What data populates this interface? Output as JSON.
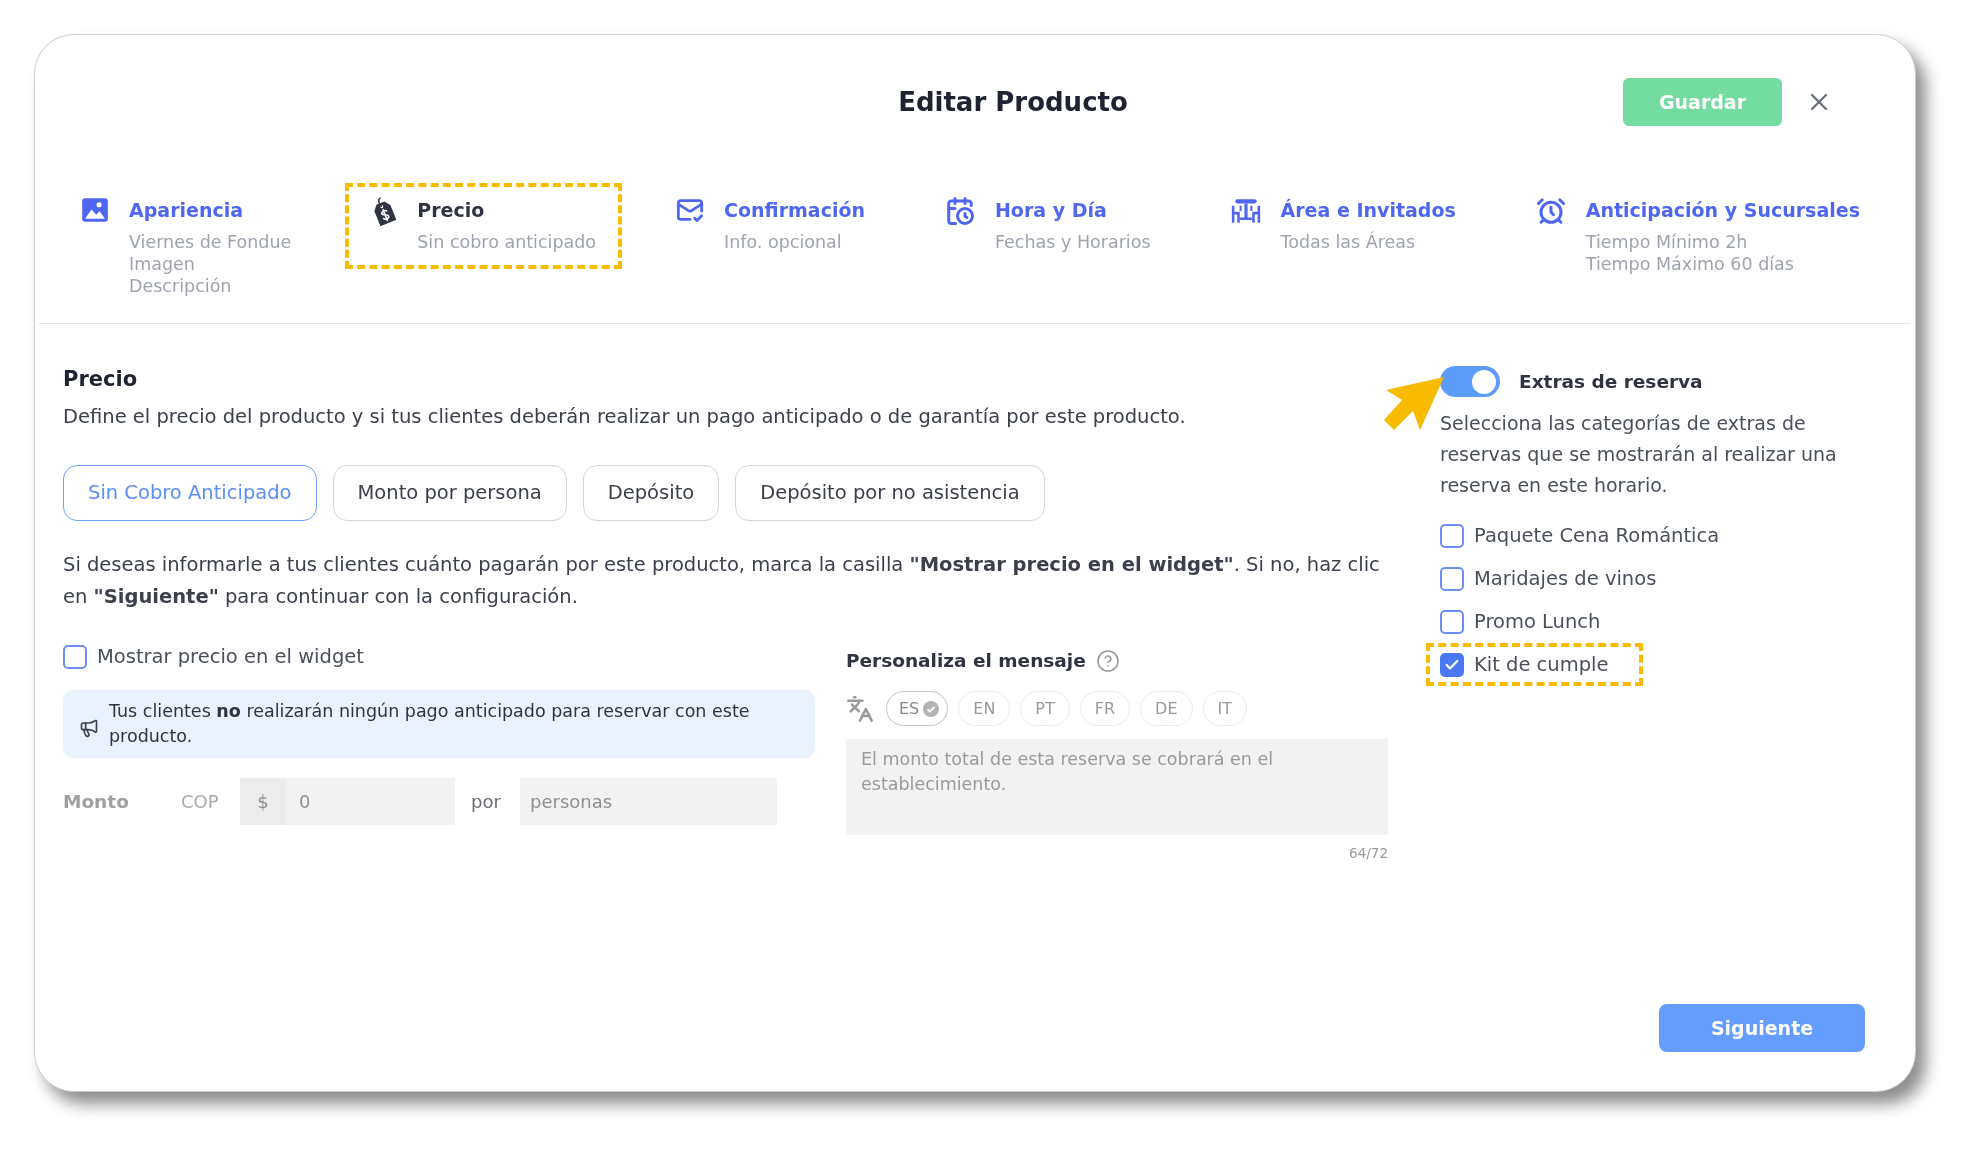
{
  "dialog": {
    "title": "Editar Producto",
    "save_button": "Guardar"
  },
  "tabs": [
    {
      "title": "Apariencia",
      "details": [
        "Viernes de Fondue",
        "Imagen",
        "Descripción"
      ],
      "selected": false,
      "highlighted": false
    },
    {
      "title": "Precio",
      "details": [
        "Sin cobro anticipado"
      ],
      "selected": true,
      "highlighted": true
    },
    {
      "title": "Confirmación",
      "details": [
        "Info. opcional"
      ],
      "selected": false,
      "highlighted": false
    },
    {
      "title": "Hora y Día",
      "details": [
        "Fechas y Horarios"
      ],
      "selected": false,
      "highlighted": false
    },
    {
      "title": "Área e Invitados",
      "details": [
        "Todas las Áreas"
      ],
      "selected": false,
      "highlighted": false
    },
    {
      "title": "Anticipación y Sucursales",
      "details": [
        "Tiempo Mínimo 2h",
        "Tiempo Máximo 60 días"
      ],
      "selected": false,
      "highlighted": false
    }
  ],
  "price": {
    "heading": "Precio",
    "description": "Define el precio del producto y si tus clientes deberán realizar un pago anticipado o de garantía por este producto.",
    "options": [
      {
        "label": "Sin Cobro Anticipado",
        "selected": true
      },
      {
        "label": "Monto por persona",
        "selected": false
      },
      {
        "label": "Depósito",
        "selected": false
      },
      {
        "label": "Depósito por no asistencia",
        "selected": false
      }
    ],
    "info": "Si deseas informarle a tus clientes cuánto pagarán por este producto, marca la casilla **\"Mostrar precio en el widget\"**. Si no, haz clic en **\"Siguiente\"** para continuar con la configuración.",
    "show_price": {
      "label": "Mostrar precio en el widget",
      "checked": false
    },
    "notice": "Tus clientes **no** realizarán ningún pago anticipado para reservar con este producto.",
    "amount": {
      "label": "Monto",
      "currency": "COP",
      "symbol": "$",
      "value": "0",
      "per": "por",
      "unit_placeholder": "personas",
      "disabled": true
    }
  },
  "message": {
    "heading": "Personaliza el mensaje",
    "languages": [
      {
        "code": "ES",
        "selected": true
      },
      {
        "code": "EN",
        "selected": false
      },
      {
        "code": "PT",
        "selected": false
      },
      {
        "code": "FR",
        "selected": false
      },
      {
        "code": "DE",
        "selected": false
      },
      {
        "code": "IT",
        "selected": false
      }
    ],
    "text": "El monto total de esta reserva se cobrará en el establecimiento.",
    "counter": "64/72",
    "disabled": true
  },
  "extras": {
    "title": "Extras de reserva",
    "enabled": true,
    "pointer": true,
    "description": "Selecciona las categorías de extras de reservas que se mostrarán al realizar una reserva en este horario.",
    "items": [
      {
        "label": "Paquete Cena Romántica",
        "checked": false,
        "highlighted": false
      },
      {
        "label": "Maridajes de vinos",
        "checked": false,
        "highlighted": false
      },
      {
        "label": "Promo Lunch",
        "checked": false,
        "highlighted": false
      },
      {
        "label": "Kit de cumple",
        "checked": true,
        "highlighted": true
      }
    ]
  },
  "footer": {
    "next_button": "Siguiente"
  }
}
